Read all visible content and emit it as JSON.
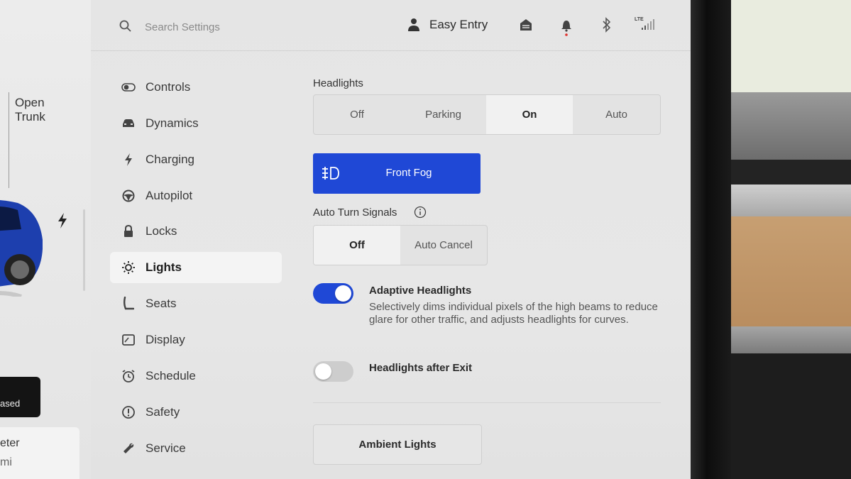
{
  "car_panel": {
    "trunk_label_line1": "Open",
    "trunk_label_line2": "Trunk",
    "release_partial": "ased",
    "odometer_label_partial": "eter",
    "odometer_unit_partial": "mi"
  },
  "topbar": {
    "search_placeholder": "Search Settings",
    "profile_name": "Easy Entry",
    "network_label": "LTE"
  },
  "sidebar": {
    "items": [
      {
        "label": "Controls",
        "icon": "toggle-icon"
      },
      {
        "label": "Dynamics",
        "icon": "car-icon"
      },
      {
        "label": "Charging",
        "icon": "bolt-icon"
      },
      {
        "label": "Autopilot",
        "icon": "steering-wheel-icon"
      },
      {
        "label": "Locks",
        "icon": "lock-icon"
      },
      {
        "label": "Lights",
        "icon": "sun-icon",
        "active": true
      },
      {
        "label": "Seats",
        "icon": "seat-icon"
      },
      {
        "label": "Display",
        "icon": "display-icon"
      },
      {
        "label": "Schedule",
        "icon": "alarm-clock-icon"
      },
      {
        "label": "Safety",
        "icon": "alert-circle-icon"
      },
      {
        "label": "Service",
        "icon": "wrench-icon"
      }
    ]
  },
  "content": {
    "headlights": {
      "label": "Headlights",
      "options": [
        "Off",
        "Parking",
        "On",
        "Auto"
      ],
      "selected": "On"
    },
    "front_fog": {
      "label": "Front Fog",
      "icon": "fog-light-icon",
      "active": true
    },
    "auto_turn_signals": {
      "label": "Auto Turn Signals",
      "options": [
        "Off",
        "Auto Cancel"
      ],
      "selected": "Off"
    },
    "adaptive_headlights": {
      "title": "Adaptive Headlights",
      "description": "Selectively dims individual pixels of the high beams to reduce glare for other traffic, and adjusts headlights for curves.",
      "enabled": true
    },
    "headlights_after_exit": {
      "title": "Headlights after Exit",
      "enabled": false
    },
    "ambient_lights_button": "Ambient Lights"
  },
  "colors": {
    "accent": "#1f48d6",
    "panel_bg": "#e5e5e5",
    "selected_segment": "#f1f1f1"
  }
}
